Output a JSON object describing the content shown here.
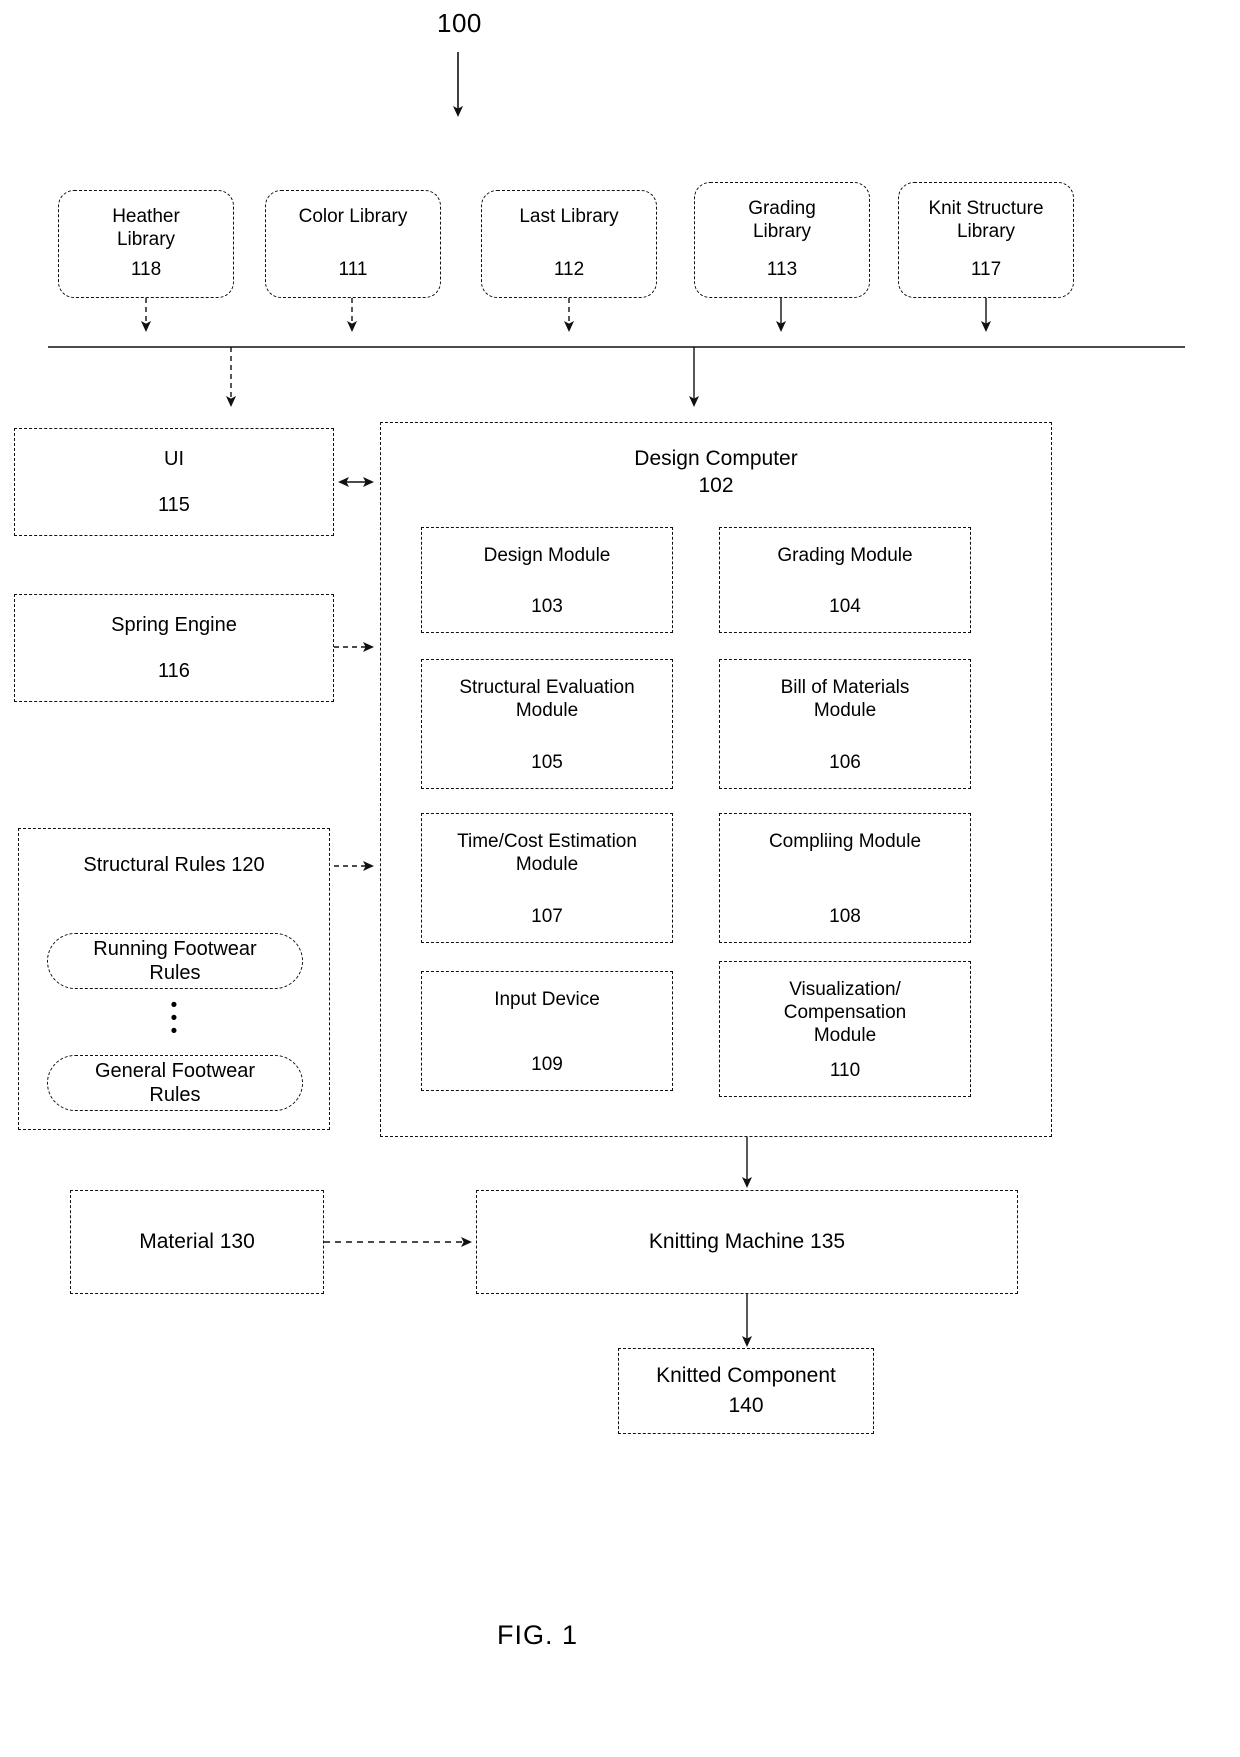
{
  "figure": {
    "top_number": "100",
    "caption": "FIG. 1"
  },
  "libraries": [
    {
      "id": "heather",
      "label": "Heather\nLibrary",
      "number": "118"
    },
    {
      "id": "color",
      "label": "Color Library",
      "number": "111"
    },
    {
      "id": "last",
      "label": "Last Library",
      "number": "112"
    },
    {
      "id": "grading",
      "label": "Grading\nLibrary",
      "number": "113"
    },
    {
      "id": "knit-structure",
      "label": "Knit Structure\nLibrary",
      "number": "117"
    }
  ],
  "left_column": [
    {
      "id": "ui",
      "label": "UI",
      "number": "115"
    },
    {
      "id": "spring-engine",
      "label": "Spring Engine",
      "number": "116"
    }
  ],
  "structural_rules": {
    "title": "Structural Rules  120",
    "rules": [
      {
        "id": "running-footwear-rules",
        "label": "Running Footwear\nRules"
      },
      {
        "id": "general-footwear-rules",
        "label": "General Footwear\nRules"
      }
    ],
    "ellipsis": "•"
  },
  "design_computer": {
    "title": "Design Computer",
    "number": "102",
    "modules": [
      {
        "id": "design-module",
        "label": "Design Module",
        "number": "103"
      },
      {
        "id": "grading-module",
        "label": "Grading Module",
        "number": "104"
      },
      {
        "id": "structural-evaluation-module",
        "label": "Structural Evaluation\nModule",
        "number": "105"
      },
      {
        "id": "bill-of-materials-module",
        "label": "Bill of Materials\nModule",
        "number": "106"
      },
      {
        "id": "time-cost-estimation-module",
        "label": "Time/Cost Estimation\nModule",
        "number": "107"
      },
      {
        "id": "compliing-module",
        "label": "Compliing Module",
        "number": "108"
      },
      {
        "id": "input-device",
        "label": "Input Device",
        "number": "109"
      },
      {
        "id": "visualization-compensation-module",
        "label": "Visualization/\nCompensation\nModule",
        "number": "110"
      }
    ]
  },
  "output_chain": {
    "material": "Material   130",
    "knitting_machine": "Knitting Machine   135",
    "knitted_component_label": "Knitted Component",
    "knitted_component_number": "140"
  },
  "colors": {
    "stroke": "#111111",
    "background": "#ffffff",
    "text": "#000000"
  }
}
